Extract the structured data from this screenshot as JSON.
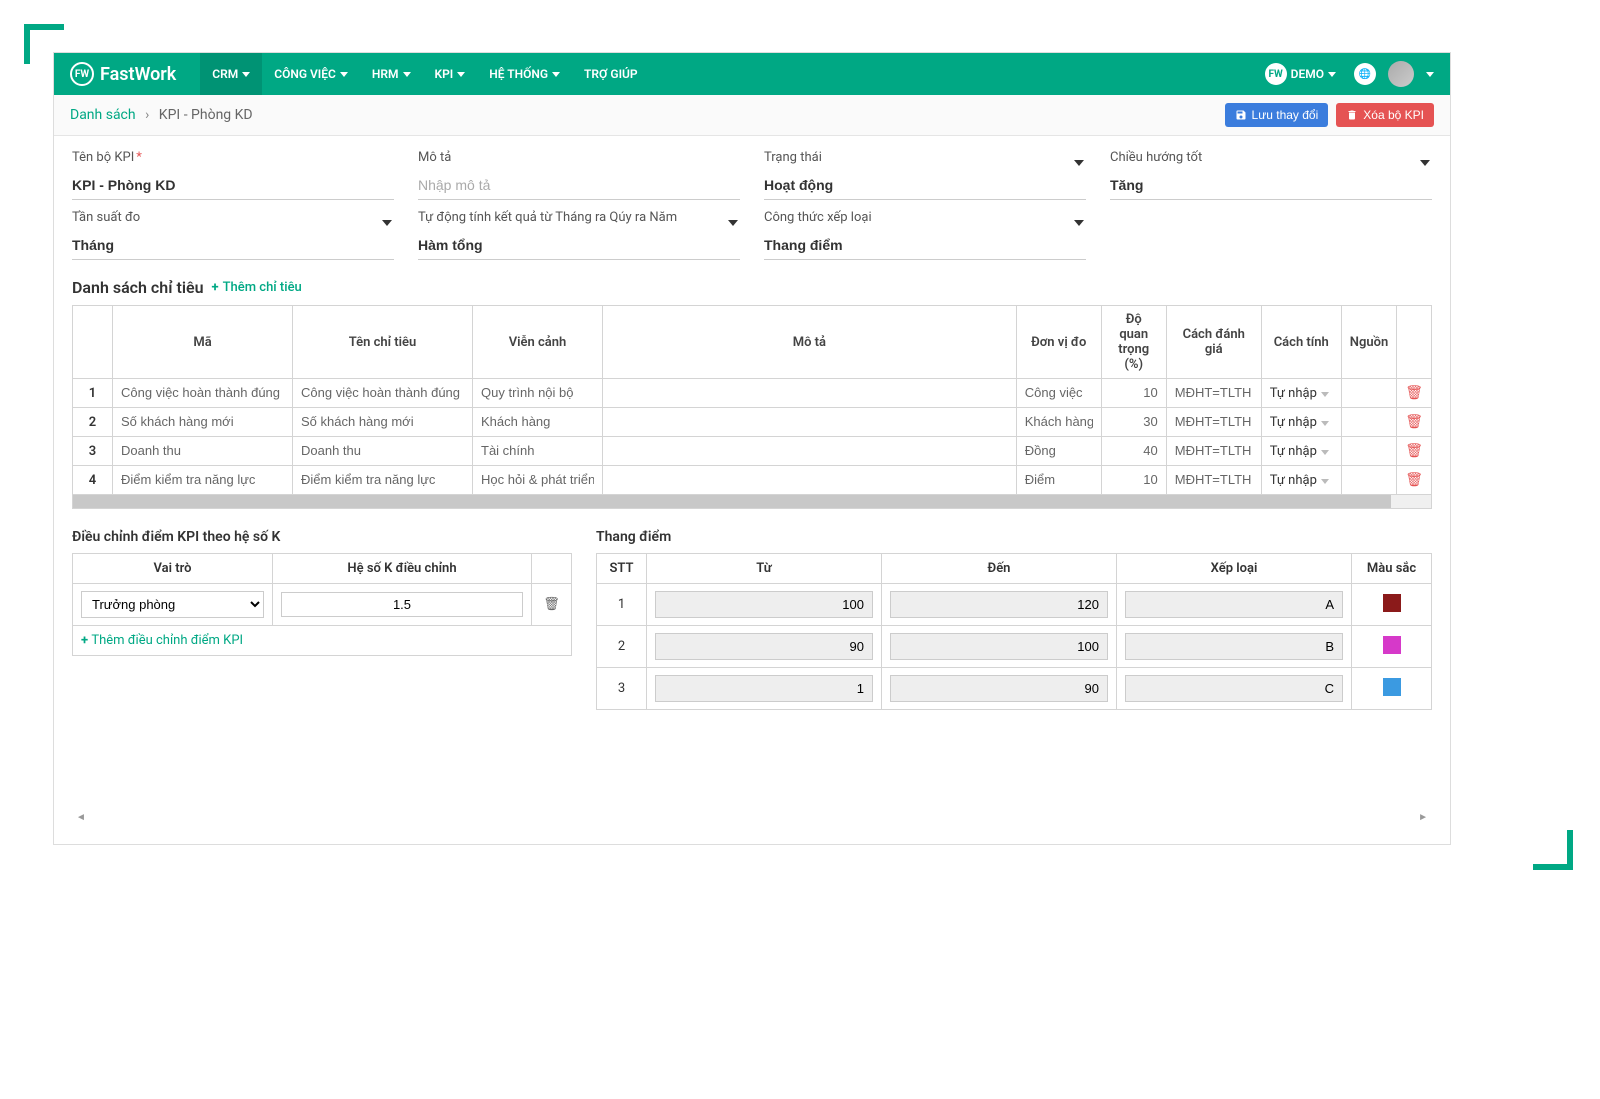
{
  "brand": "FastWork",
  "nav": {
    "items": [
      "CRM",
      "CÔNG VIỆC",
      "HRM",
      "KPI",
      "HỆ THỐNG",
      "TRỢ GIÚP"
    ],
    "user": "DEMO"
  },
  "breadcrumb": {
    "root": "Danh sách",
    "current": "KPI - Phòng KD"
  },
  "actions": {
    "save": "Lưu thay đổi",
    "delete": "Xóa bộ KPI"
  },
  "form": {
    "name_label": "Tên bộ KPI",
    "name_value": "KPI - Phòng KD",
    "desc_label": "Mô tả",
    "desc_placeholder": "Nhập mô tả",
    "status_label": "Trạng thái",
    "status_value": "Hoạt động",
    "direction_label": "Chiều hướng tốt",
    "direction_value": "Tăng",
    "freq_label": "Tần suất đo",
    "freq_value": "Tháng",
    "autocalc_label": "Tự động tính kết quả từ Tháng ra Qúy ra Năm",
    "autocalc_value": "Hàm tổng",
    "formula_label": "Công thức xếp loại",
    "formula_value": "Thang điểm"
  },
  "criteria": {
    "title": "Danh sách chỉ tiêu",
    "add": "Thêm chỉ tiêu",
    "headers": {
      "ma": "Mã",
      "ten": "Tên chỉ tiêu",
      "vien": "Viễn cảnh",
      "mota": "Mô tả",
      "donvi": "Đơn vị đo",
      "doquan": "Độ quan trọng (%)",
      "danhgia": "Cách đánh giá",
      "tinh": "Cách tính",
      "nguon": "Nguồn"
    },
    "rows": [
      {
        "n": "1",
        "ma": "Công việc hoàn thành đúng hạn",
        "ten": "Công việc hoàn thành đúng hạn",
        "vien": "Quy trình nội bộ",
        "donvi": "Công việc",
        "doquan": "10",
        "danhgia": "MĐHT=TLTH",
        "tinh": "Tự nhập"
      },
      {
        "n": "2",
        "ma": "Số khách hàng mới",
        "ten": "Số khách hàng mới",
        "vien": "Khách hàng",
        "donvi": "Khách hàng",
        "doquan": "30",
        "danhgia": "MĐHT=TLTH",
        "tinh": "Tự nhập"
      },
      {
        "n": "3",
        "ma": "Doanh thu",
        "ten": "Doanh thu",
        "vien": "Tài chính",
        "donvi": "Đồng",
        "doquan": "40",
        "danhgia": "MĐHT=TLTH",
        "tinh": "Tự nhập"
      },
      {
        "n": "4",
        "ma": "Điểm kiểm tra năng lực",
        "ten": "Điểm kiểm tra năng lực",
        "vien": "Học hỏi & phát triển",
        "donvi": "Điểm",
        "doquan": "10",
        "danhgia": "MĐHT=TLTH",
        "tinh": "Tự nhập"
      }
    ]
  },
  "koeff": {
    "title": "Điều chỉnh điểm KPI theo hệ số K",
    "headers": {
      "role": "Vai trò",
      "k": "Hệ số K điều chỉnh"
    },
    "row": {
      "role": "Trưởng phòng",
      "k": "1.5"
    },
    "add": "Thêm điều chỉnh điểm KPI"
  },
  "scale": {
    "title": "Thang điểm",
    "headers": {
      "stt": "STT",
      "tu": "Từ",
      "den": "Đến",
      "xep": "Xếp loại",
      "mau": "Màu sắc"
    },
    "rows": [
      {
        "n": "1",
        "tu": "100",
        "den": "120",
        "xep": "A",
        "color": "#8b1a1a"
      },
      {
        "n": "2",
        "tu": "90",
        "den": "100",
        "xep": "B",
        "color": "#d639c9"
      },
      {
        "n": "3",
        "tu": "1",
        "den": "90",
        "xep": "C",
        "color": "#3b9ae1"
      }
    ]
  }
}
